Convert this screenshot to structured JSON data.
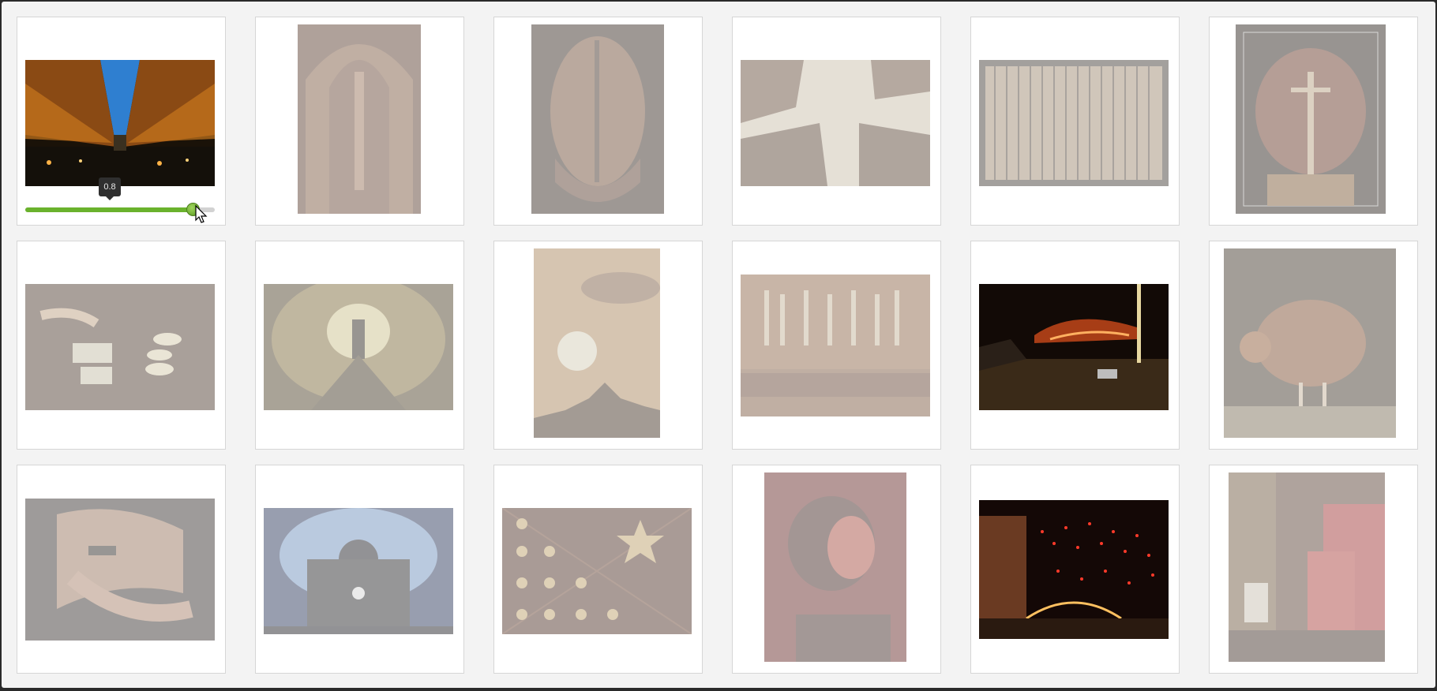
{
  "slider": {
    "value": 0.8,
    "value_label": "0.8"
  },
  "photos": [
    {
      "name": "photo-bridge-underside",
      "faded": false
    },
    {
      "name": "photo-cathedral-ceiling",
      "faded": true
    },
    {
      "name": "photo-ornate-mask",
      "faded": true
    },
    {
      "name": "photo-skyscrapers-looking-up",
      "faded": true
    },
    {
      "name": "photo-window-grille",
      "faded": true
    },
    {
      "name": "photo-crucifix-altar",
      "faded": true
    },
    {
      "name": "photo-candles",
      "faded": true
    },
    {
      "name": "photo-tunnel-figure",
      "faded": true
    },
    {
      "name": "photo-sunset-statue",
      "faded": true
    },
    {
      "name": "photo-arabic-calligraphy",
      "faded": true
    },
    {
      "name": "photo-night-wildfire",
      "faded": false
    },
    {
      "name": "photo-chicken",
      "faded": true
    },
    {
      "name": "photo-hands-closeup",
      "faded": true
    },
    {
      "name": "photo-laptop-glow",
      "faded": true
    },
    {
      "name": "photo-star-ceiling",
      "faded": true
    },
    {
      "name": "photo-woman-red-light",
      "faded": true
    },
    {
      "name": "photo-riverwalk-lights",
      "faded": false
    },
    {
      "name": "photo-cafe-interior",
      "faded": true
    }
  ]
}
